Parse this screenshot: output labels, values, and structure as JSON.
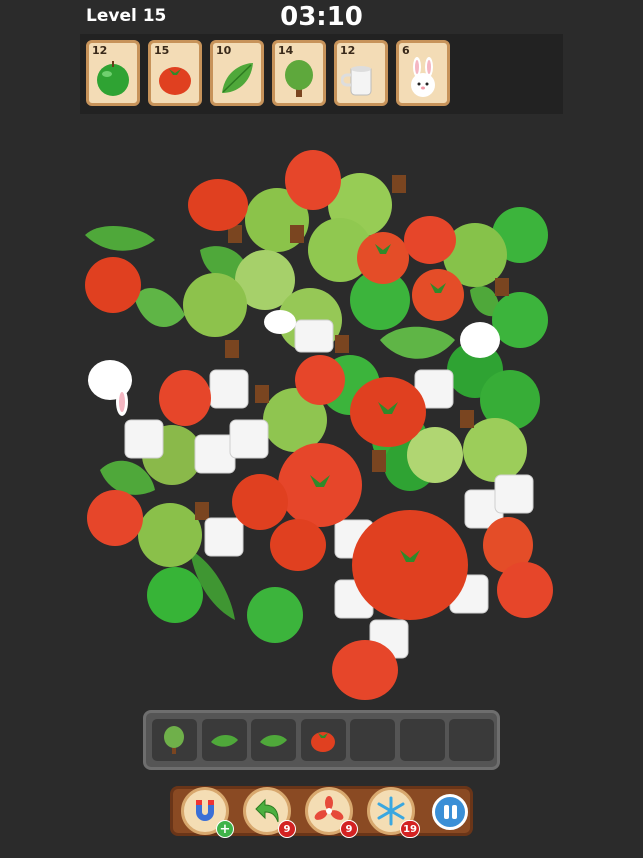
{
  "header": {
    "level": "Level 15",
    "timer": "03:10"
  },
  "goals": [
    {
      "count": "12",
      "icon": "green-apple-icon",
      "color": "#3cb43c"
    },
    {
      "count": "15",
      "icon": "tomato-icon",
      "color": "#e6462a"
    },
    {
      "count": "10",
      "icon": "leaf-icon",
      "color": "#5fb546"
    },
    {
      "count": "14",
      "icon": "tree-icon",
      "color": "#7cba48"
    },
    {
      "count": "12",
      "icon": "mug-icon",
      "color": "#f2f2f2"
    },
    {
      "count": "6",
      "icon": "bunny-icon",
      "color": "#ffffff"
    }
  ],
  "tray": {
    "slots": [
      "tree-icon",
      "leaf-icon",
      "leaf-icon",
      "tomato-icon",
      "",
      "",
      ""
    ]
  },
  "powerups": [
    {
      "name": "magnet-icon",
      "badge": "+"
    },
    {
      "name": "undo-icon",
      "badge": "9"
    },
    {
      "name": "fan-icon",
      "badge": "9"
    },
    {
      "name": "freeze-icon",
      "badge": "19"
    }
  ],
  "colors": {
    "tomato": "#e6462a",
    "apple": "#3cb43c",
    "pear": "#9ccd5a",
    "leaf": "#5fb546",
    "mug": "#f5f5f5"
  }
}
